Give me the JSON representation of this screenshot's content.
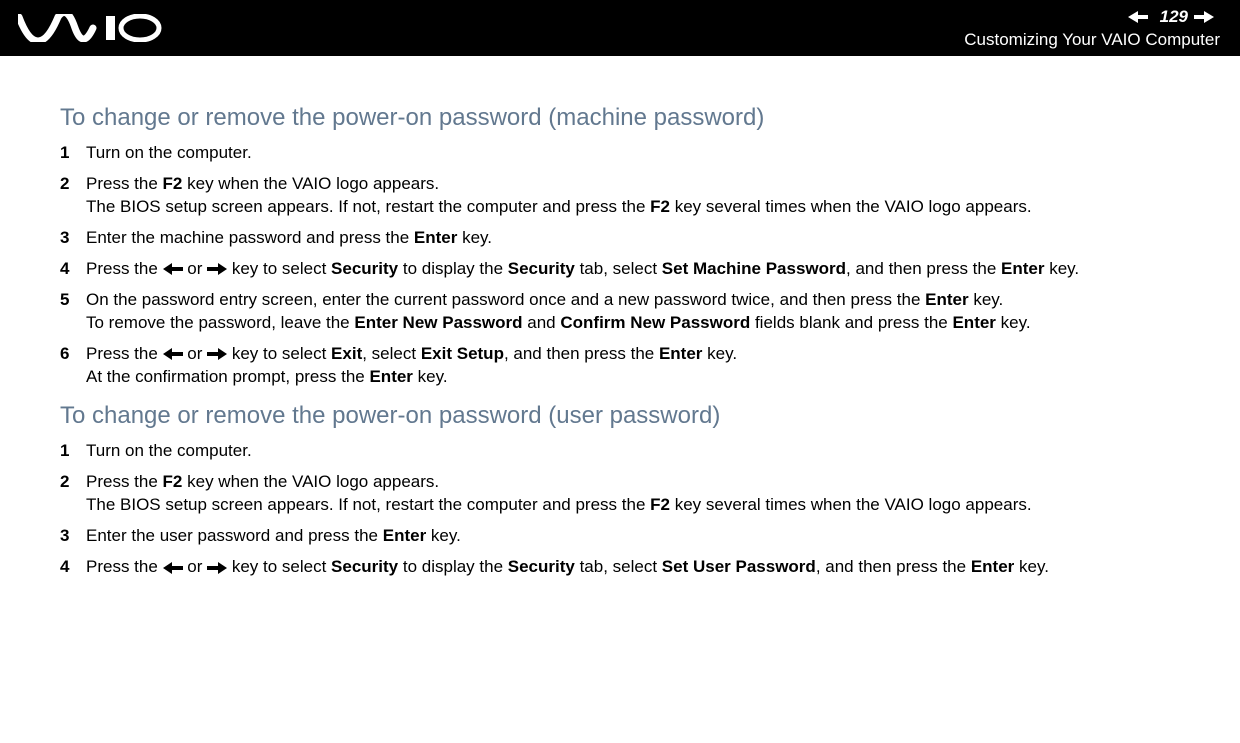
{
  "header": {
    "page_number": "129",
    "chapter_title": "Customizing Your VAIO Computer"
  },
  "logo_name": "vaio-logo",
  "sections": [
    {
      "heading": "To change or remove the power-on password (machine password)",
      "steps": [
        {
          "num": "1",
          "parts": [
            {
              "t": "Turn on the computer."
            }
          ]
        },
        {
          "num": "2",
          "parts": [
            {
              "t": "Press the "
            },
            {
              "b": "F2"
            },
            {
              "t": " key when the VAIO logo appears."
            },
            {
              "br": true
            },
            {
              "t": "The BIOS setup screen appears. If not, restart the computer and press the "
            },
            {
              "b": "F2"
            },
            {
              "t": " key several times when the VAIO logo appears."
            }
          ]
        },
        {
          "num": "3",
          "parts": [
            {
              "t": "Enter the machine password and press the "
            },
            {
              "b": "Enter"
            },
            {
              "t": " key."
            }
          ]
        },
        {
          "num": "4",
          "parts": [
            {
              "t": "Press the "
            },
            {
              "arrow": "left"
            },
            {
              "t": " or "
            },
            {
              "arrow": "right"
            },
            {
              "t": " key to select "
            },
            {
              "b": "Security"
            },
            {
              "t": " to display the "
            },
            {
              "b": "Security"
            },
            {
              "t": " tab, select "
            },
            {
              "b": "Set Machine Password"
            },
            {
              "t": ", and then press the "
            },
            {
              "b": "Enter"
            },
            {
              "t": " key."
            }
          ]
        },
        {
          "num": "5",
          "parts": [
            {
              "t": "On the password entry screen, enter the current password once and a new password twice, and then press the "
            },
            {
              "b": "Enter"
            },
            {
              "t": " key."
            },
            {
              "br": true
            },
            {
              "t": "To remove the password, leave the "
            },
            {
              "b": "Enter New Password"
            },
            {
              "t": " and "
            },
            {
              "b": "Confirm New Password"
            },
            {
              "t": " fields blank and press the "
            },
            {
              "b": "Enter"
            },
            {
              "t": " key."
            }
          ]
        },
        {
          "num": "6",
          "parts": [
            {
              "t": "Press the "
            },
            {
              "arrow": "left"
            },
            {
              "t": " or "
            },
            {
              "arrow": "right"
            },
            {
              "t": " key to select "
            },
            {
              "b": "Exit"
            },
            {
              "t": ", select "
            },
            {
              "b": "Exit Setup"
            },
            {
              "t": ", and then press the "
            },
            {
              "b": "Enter"
            },
            {
              "t": " key."
            },
            {
              "br": true
            },
            {
              "t": "At the confirmation prompt, press the "
            },
            {
              "b": "Enter"
            },
            {
              "t": " key."
            }
          ]
        }
      ]
    },
    {
      "heading": "To change or remove the power-on password (user password)",
      "steps": [
        {
          "num": "1",
          "parts": [
            {
              "t": "Turn on the computer."
            }
          ]
        },
        {
          "num": "2",
          "parts": [
            {
              "t": "Press the "
            },
            {
              "b": "F2"
            },
            {
              "t": " key when the VAIO logo appears."
            },
            {
              "br": true
            },
            {
              "t": "The BIOS setup screen appears. If not, restart the computer and press the "
            },
            {
              "b": "F2"
            },
            {
              "t": " key several times when the VAIO logo appears."
            }
          ]
        },
        {
          "num": "3",
          "parts": [
            {
              "t": "Enter the user password and press the "
            },
            {
              "b": "Enter"
            },
            {
              "t": " key."
            }
          ]
        },
        {
          "num": "4",
          "parts": [
            {
              "t": "Press the "
            },
            {
              "arrow": "left"
            },
            {
              "t": " or "
            },
            {
              "arrow": "right"
            },
            {
              "t": " key to select "
            },
            {
              "b": "Security"
            },
            {
              "t": " to display the "
            },
            {
              "b": "Security"
            },
            {
              "t": " tab, select "
            },
            {
              "b": "Set User Password"
            },
            {
              "t": ", and then press the "
            },
            {
              "b": "Enter"
            },
            {
              "t": " key."
            }
          ]
        }
      ]
    }
  ]
}
